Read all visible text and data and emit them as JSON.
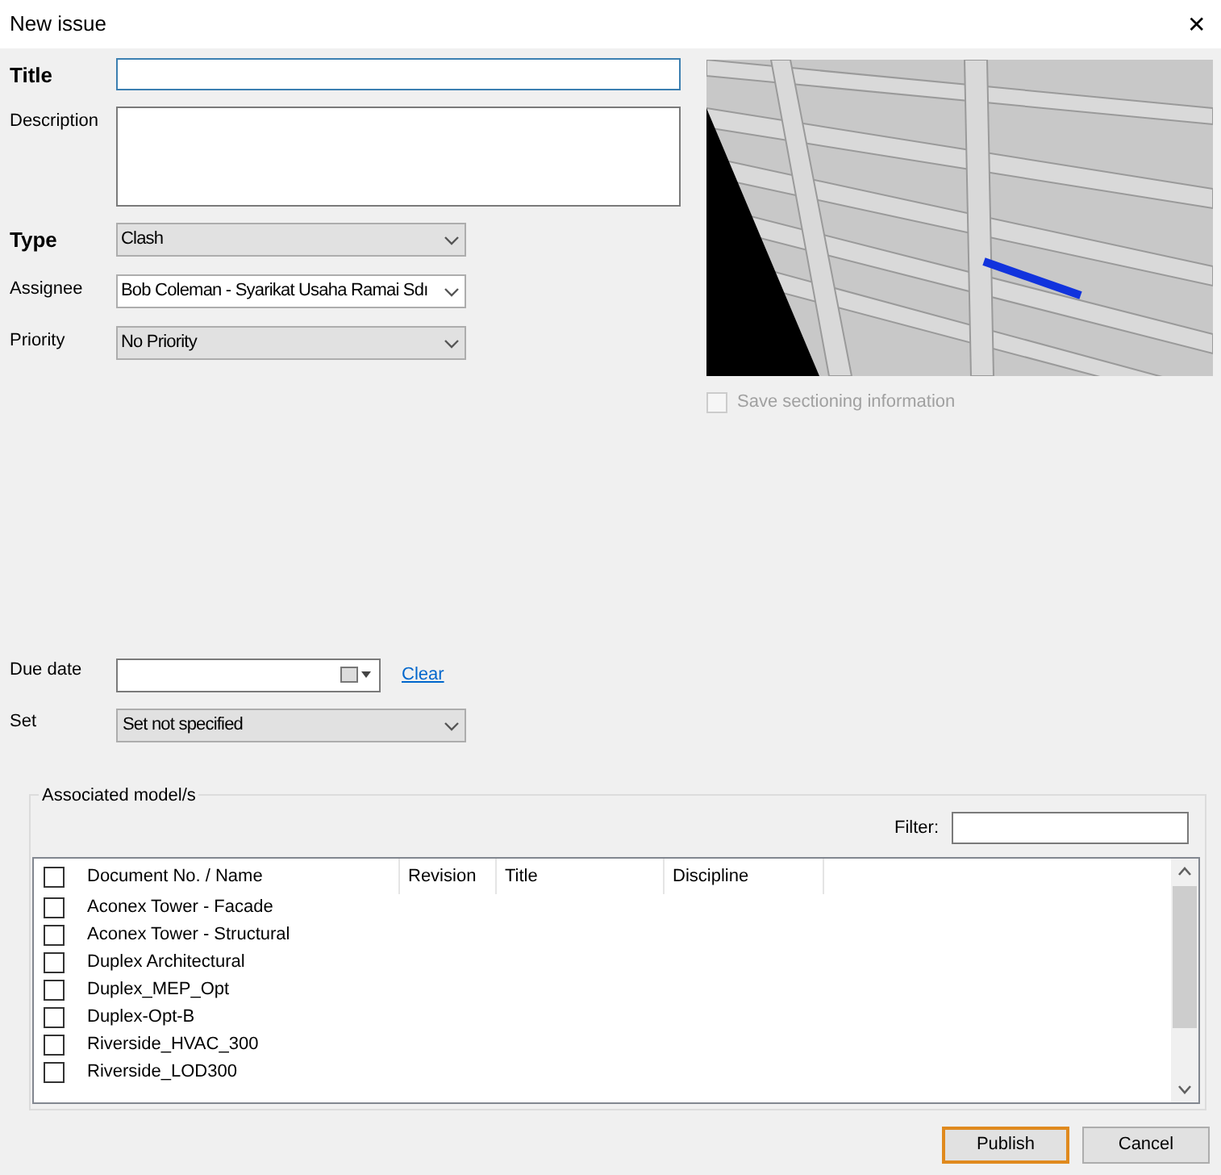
{
  "window": {
    "title": "New issue",
    "close": "✕"
  },
  "fields": [
    {
      "label": "Title",
      "required": true,
      "kind": "text"
    },
    {
      "label": "Description",
      "required": false,
      "kind": "textarea"
    },
    {
      "label": "Type",
      "required": true,
      "kind": "select",
      "value": "Clash",
      "editable": false
    },
    {
      "label": "Assignee",
      "required": false,
      "kind": "select",
      "value": "Bob Coleman - Syarikat Usaha Ramai Sdı",
      "editable": true
    },
    {
      "label": "Priority",
      "required": false,
      "kind": "select",
      "value": "No Priority",
      "editable": false
    }
  ],
  "save_sectioning": {
    "label": "Save sectioning information",
    "checked": false,
    "disabled": true
  },
  "due_date": {
    "label": "Due date",
    "link": "Clear"
  },
  "set": {
    "label": "Set",
    "value": "Set not specified",
    "editable": false
  },
  "associated_models": {
    "title": "Associated model/s",
    "filter_label": "Filter:",
    "header_checked": false,
    "columns": [
      "Document No. / Name",
      "Revision",
      "Title",
      "Discipline"
    ],
    "rows": [
      {
        "name": "Aconex Tower - Facade",
        "checked": false
      },
      {
        "name": "Aconex Tower - Structural",
        "checked": false
      },
      {
        "name": "Duplex Architectural",
        "checked": false
      },
      {
        "name": "Duplex_MEP_Opt",
        "checked": false
      },
      {
        "name": "Duplex-Opt-B",
        "checked": false
      },
      {
        "name": "Riverside_HVAC_300",
        "checked": false
      },
      {
        "name": "Riverside_LOD300",
        "checked": false
      }
    ]
  },
  "buttons": [
    {
      "label": "Publish",
      "default": true
    },
    {
      "label": "Cancel",
      "default": false
    }
  ]
}
